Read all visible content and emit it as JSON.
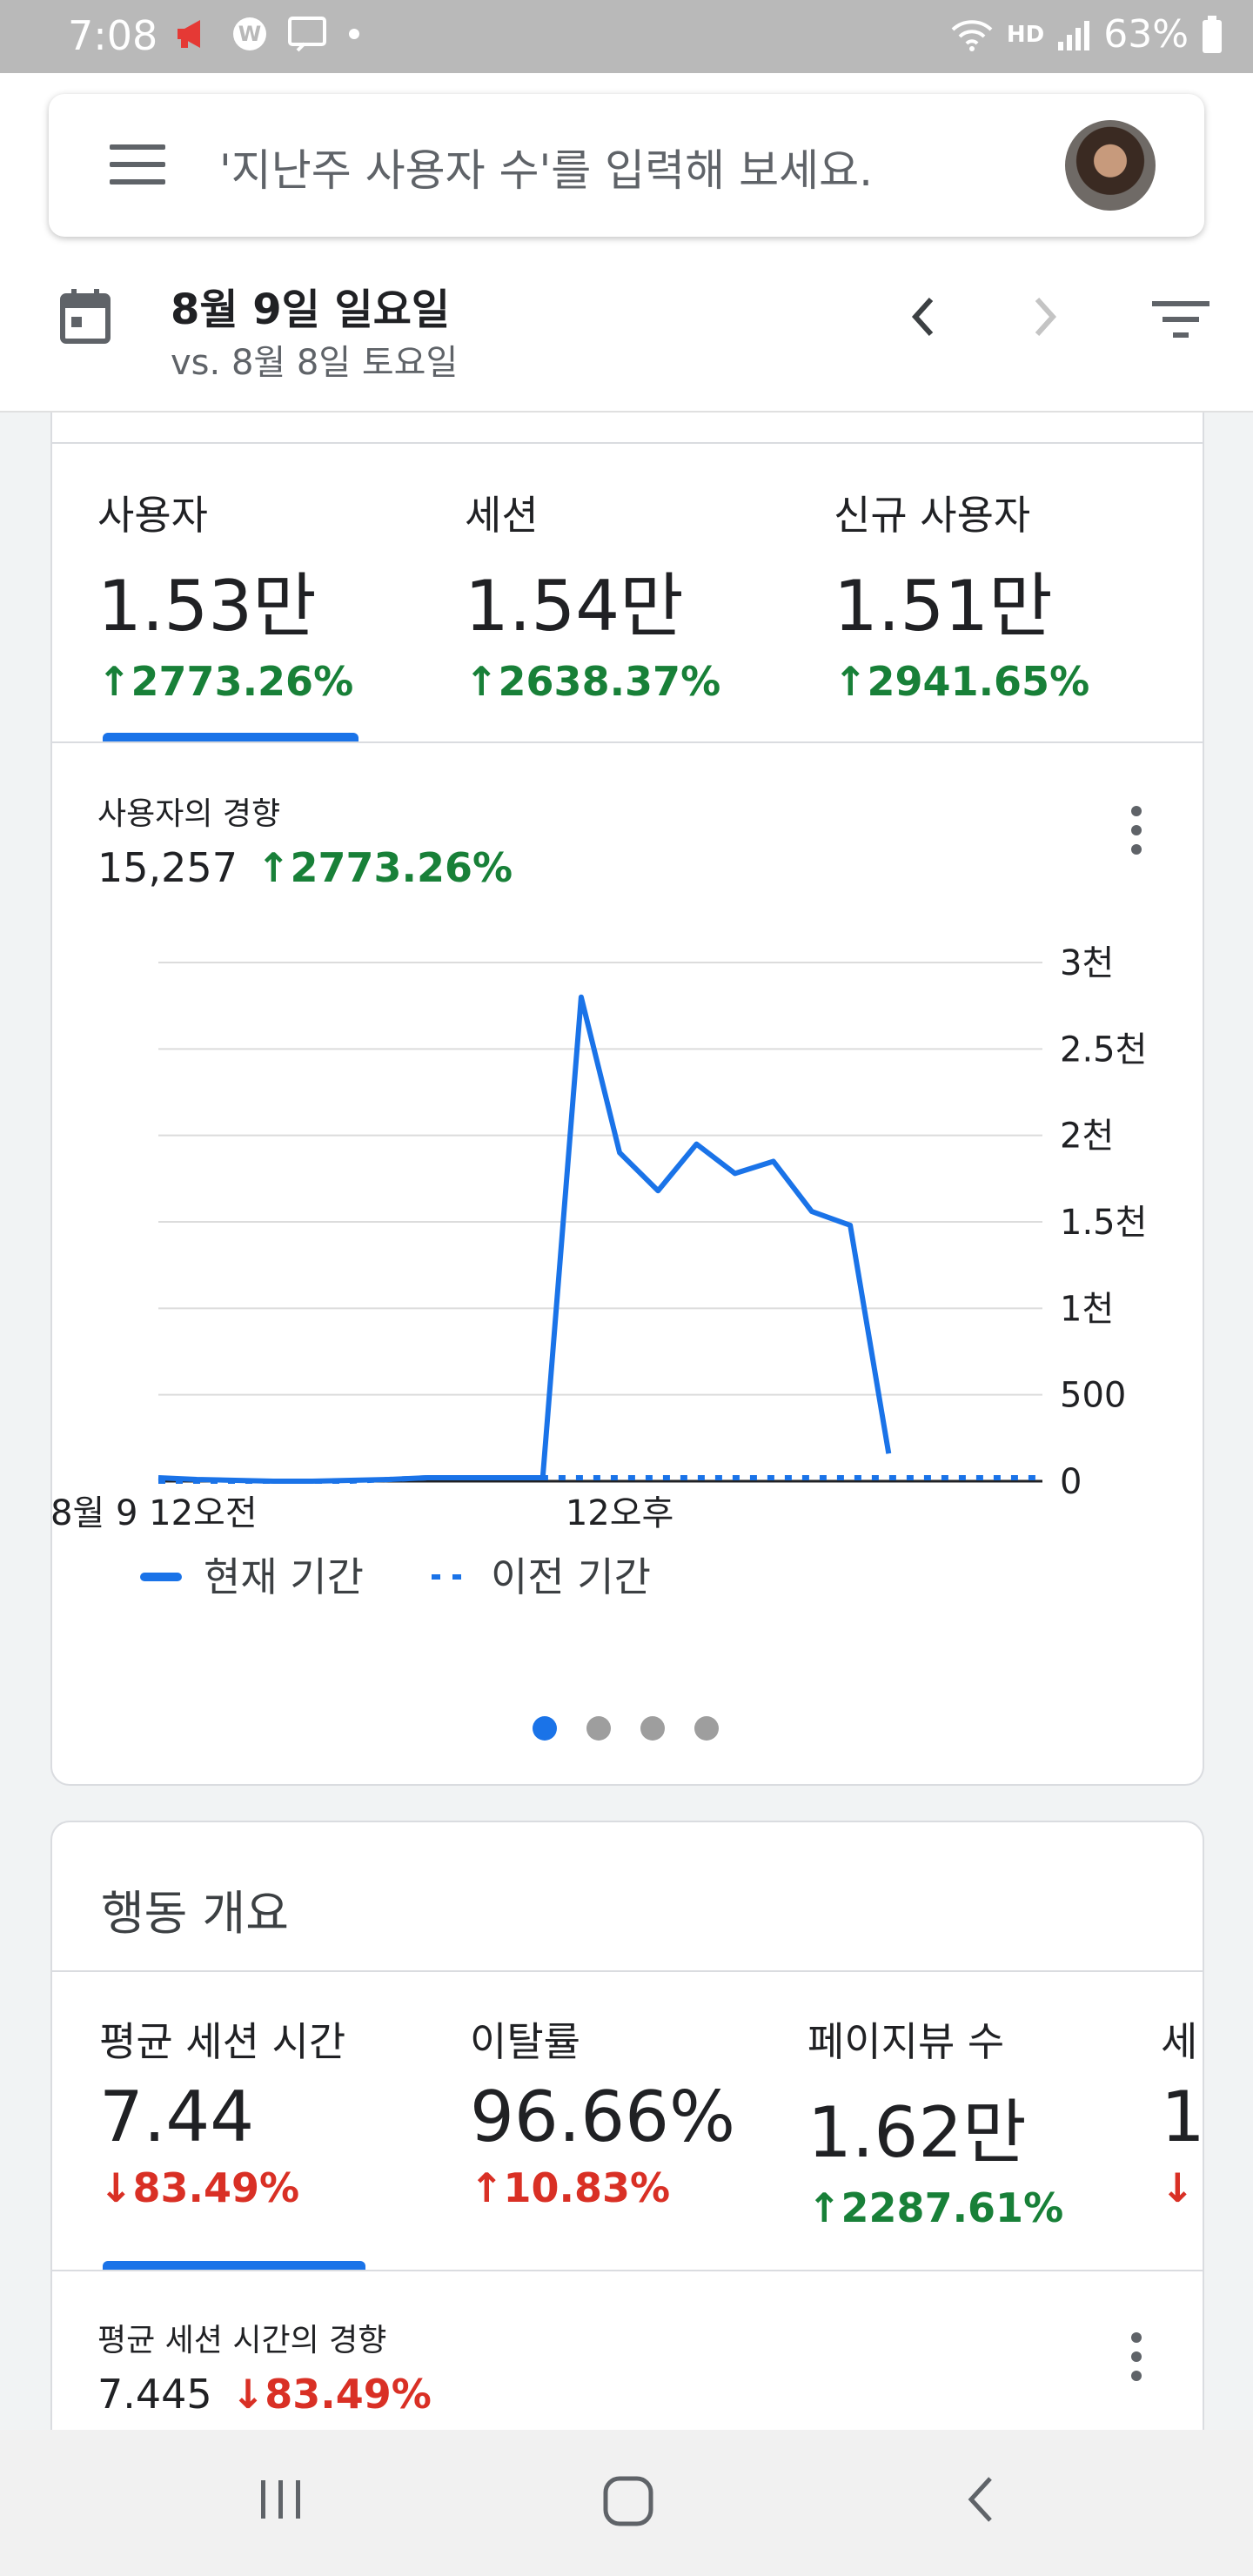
{
  "status_bar": {
    "time": "7:08",
    "network_label": "HD",
    "battery": "63%"
  },
  "search": {
    "placeholder": "'지난주 사용자 수'를 입력해 보세요."
  },
  "date_bar": {
    "current": "8월 9일 일요일",
    "compare": "vs. 8월 8일 토요일"
  },
  "overview": {
    "metrics": [
      {
        "label": "사용자",
        "value": "1.53만",
        "delta": "2773.26%",
        "direction": "up"
      },
      {
        "label": "세션",
        "value": "1.54만",
        "delta": "2638.37%",
        "direction": "up"
      },
      {
        "label": "신규 사용자",
        "value": "1.51만",
        "delta": "2941.65%",
        "direction": "up"
      }
    ],
    "trend": {
      "title": "사용자의 경향",
      "value": "15,257",
      "delta": "2773.26%",
      "direction": "up"
    },
    "legend": {
      "current": "현재 기간",
      "previous": "이전 기간"
    },
    "pager": {
      "count": 4,
      "active": 0
    }
  },
  "behavior": {
    "title": "행동 개요",
    "metrics": [
      {
        "label": "평균 세션 시간",
        "value": "7.44",
        "delta": "83.49%",
        "direction": "down"
      },
      {
        "label": "이탈률",
        "value": "96.66%",
        "delta": "10.83%",
        "direction": "up"
      },
      {
        "label": "페이지뷰 수",
        "value": "1.62만",
        "delta": "2287.61%",
        "direction": "up"
      },
      {
        "label": "세",
        "value": "1.",
        "delta": "",
        "direction": "down"
      }
    ],
    "trend": {
      "title": "평균 세션 시간의 경향",
      "value": "7.445",
      "delta": "83.49%",
      "direction": "down"
    }
  },
  "colors": {
    "accent": "#1a73e8",
    "positive": "#188038",
    "negative": "#d93025"
  },
  "chart_data": {
    "type": "line",
    "title": "사용자의 경향",
    "x": [
      0,
      1,
      2,
      3,
      4,
      5,
      6,
      7,
      8,
      9,
      10,
      11,
      12,
      13,
      14,
      15,
      16,
      17,
      18,
      19,
      20,
      21,
      22,
      23
    ],
    "x_tick_labels": [
      {
        "x": 0,
        "label": "8월 9 12오전"
      },
      {
        "x": 12,
        "label": "12오후"
      }
    ],
    "y_tick_labels": [
      "0",
      "500",
      "1천",
      "1.5천",
      "2천",
      "2.5천",
      "3천"
    ],
    "y_ticks": [
      0,
      500,
      1000,
      1500,
      2000,
      2500,
      3000
    ],
    "ylim": [
      0,
      3000
    ],
    "grid": true,
    "legend_position": "bottom-left",
    "series": [
      {
        "name": "현재 기간",
        "style": "solid",
        "color": "#1a73e8",
        "values": [
          20,
          10,
          5,
          0,
          0,
          5,
          10,
          20,
          20,
          20,
          20,
          2800,
          1900,
          1680,
          1950,
          1780,
          1850,
          1560,
          1480,
          160
        ]
      },
      {
        "name": "이전 기간",
        "style": "dotted",
        "color": "#1a73e8",
        "values": [
          0,
          0,
          0,
          0,
          0,
          0,
          10,
          20,
          20,
          20,
          20,
          20,
          20,
          20,
          20,
          20,
          20,
          20,
          20,
          20,
          20,
          20,
          20,
          20
        ]
      }
    ]
  }
}
